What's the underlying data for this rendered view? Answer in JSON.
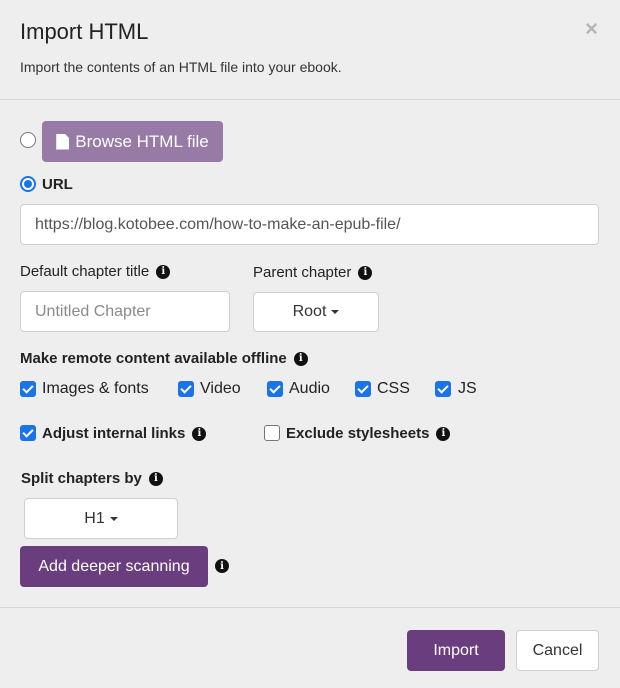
{
  "dialog": {
    "title": "Import HTML",
    "subtitle": "Import the contents of an HTML file into your ebook.",
    "close_icon": "×"
  },
  "source": {
    "browse_label": "Browse HTML file",
    "browse_selected": false,
    "url_label": "URL",
    "url_selected": true,
    "url_value": "https://blog.kotobee.com/how-to-make-an-epub-file/"
  },
  "chapter": {
    "default_title_label": "Default chapter title",
    "default_title_placeholder": "Untitled Chapter",
    "parent_label": "Parent chapter",
    "parent_value": "Root"
  },
  "offline": {
    "label": "Make remote content available offline",
    "options": [
      {
        "label": "Images & fonts",
        "checked": true
      },
      {
        "label": "Video",
        "checked": true
      },
      {
        "label": "Audio",
        "checked": true
      },
      {
        "label": "CSS",
        "checked": true
      },
      {
        "label": "JS",
        "checked": true
      }
    ]
  },
  "links": {
    "adjust_label": "Adjust internal links",
    "adjust_checked": true,
    "exclude_label": "Exclude stylesheets",
    "exclude_checked": false
  },
  "split": {
    "label": "Split chapters by",
    "value": "H1",
    "deeper_label": "Add deeper scanning"
  },
  "footer": {
    "import_label": "Import",
    "cancel_label": "Cancel"
  },
  "colors": {
    "primary": "#6a3d7e",
    "browse": "#977aa5",
    "accent": "#1a73e8"
  },
  "icons": {
    "info": "i"
  }
}
